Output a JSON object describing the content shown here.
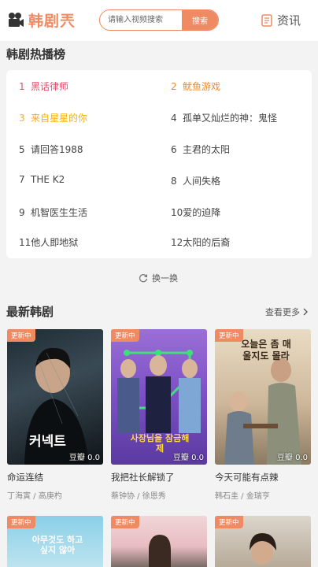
{
  "header": {
    "logo_text": "韩剧兲",
    "search_placeholder": "请输入视频搜索",
    "search_button": "搜索",
    "news_label": "资讯"
  },
  "hot": {
    "title": "韩剧热播榜",
    "items": [
      {
        "num": "1",
        "title": "黑话律师"
      },
      {
        "num": "2",
        "title": "鱿鱼游戏"
      },
      {
        "num": "3",
        "title": "来自星星的你"
      },
      {
        "num": "4",
        "title": "孤单又灿烂的神：鬼怪"
      },
      {
        "num": "5",
        "title": "请回答1988"
      },
      {
        "num": "6",
        "title": "主君的太阳"
      },
      {
        "num": "7",
        "title": "THE K2"
      },
      {
        "num": "8",
        "title": "人间失格"
      },
      {
        "num": "9",
        "title": "机智医生生活"
      },
      {
        "num": "10",
        "title": "爱的迫降"
      },
      {
        "num": "11",
        "title": "他人即地狱"
      },
      {
        "num": "12",
        "title": "太阳的后裔"
      }
    ],
    "swap_label": "换一换"
  },
  "latest": {
    "title": "最新韩剧",
    "more_label": "查看更多",
    "badge": "更新中",
    "score_label": "豆瓣",
    "cards": [
      {
        "title": "命运连结",
        "cast": "丁海寅 / 高庚杓",
        "score": "0.0",
        "poster_text": "커넥트"
      },
      {
        "title": "我把社长解锁了",
        "cast": "蔡钟协 / 徐恩秀",
        "score": "0.0",
        "poster_text": "사장님을 잠금해제"
      },
      {
        "title": "今天可能有点辣",
        "cast": "韩石圭 / 金瑞亨",
        "score": "0.0",
        "poster_text": "오늘은 좀 매울지도 몰라"
      },
      {
        "title": "",
        "cast": "",
        "score": "",
        "poster_text": "아무것도 하고 싶지 않아"
      },
      {
        "title": "",
        "cast": "",
        "score": "",
        "poster_text": ""
      },
      {
        "title": "",
        "cast": "",
        "score": "",
        "poster_text": ""
      }
    ]
  },
  "colors": {
    "accent": "#ef8a63",
    "rank1": "#e94a6b",
    "rank2": "#f08a2c",
    "rank3": "#f3b11a"
  },
  "icons": {
    "logo": "film-camera-icon",
    "news": "document-icon",
    "swap": "refresh-icon",
    "more": "chevron-right-icon"
  }
}
